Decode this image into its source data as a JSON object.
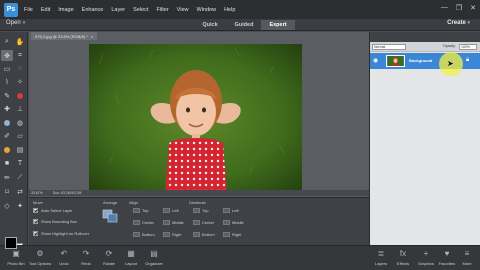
{
  "menu": {
    "logo": "Ps",
    "items": [
      "File",
      "Edit",
      "Image",
      "Enhance",
      "Layer",
      "Select",
      "Filter",
      "View",
      "Window",
      "Help"
    ]
  },
  "window_controls": {
    "minimize": "—",
    "restore": "❐",
    "close": "✕"
  },
  "modebar": {
    "open_label": "Open",
    "open_arrow": "▾",
    "modes": [
      "Quick",
      "Guided",
      "Expert"
    ],
    "active_mode": "Expert",
    "create_label": "Create",
    "create_arrow": "▾"
  },
  "document": {
    "tab_title": "975-2.jpg @ 33.8% (RGB/8) *",
    "tab_close": "×",
    "zoom": "33.87%",
    "doc_info": "Doc: 63.2M/63.2M"
  },
  "tool_options": {
    "move_title": "Move",
    "auto_select": "Auto Select Layer",
    "show_bounding_box": "Show Bounding Box",
    "show_highlight": "Show Highlight on Rollover",
    "arrange_title": "Arrange",
    "align_title": "Align",
    "align_labels": [
      "Top",
      "Left",
      "Center",
      "Middle",
      "Bottom",
      "Right"
    ],
    "distribute_title": "Distribute",
    "distribute_labels": [
      "Top",
      "Left",
      "Center",
      "Middle",
      "Bottom",
      "Right"
    ],
    "checks": {
      "auto_select": true,
      "bounding_box": true,
      "highlight": true
    }
  },
  "bottombar": {
    "left": [
      {
        "icon": "photo-bin-icon",
        "glyph": "▣",
        "label": "Photo Bin"
      },
      {
        "icon": "tool-options-icon",
        "glyph": "⚙",
        "label": "Tool Options"
      },
      {
        "icon": "undo-icon",
        "glyph": "↶",
        "label": "Undo"
      },
      {
        "icon": "redo-icon",
        "glyph": "↷",
        "label": "Redo"
      },
      {
        "icon": "rotate-icon",
        "glyph": "⟳",
        "label": "Rotate"
      },
      {
        "icon": "layout-icon",
        "glyph": "▦",
        "label": "Layout"
      },
      {
        "icon": "organizer-icon",
        "glyph": "▤",
        "label": "Organizer"
      }
    ],
    "right": [
      {
        "icon": "layers-icon",
        "glyph": "≣",
        "label": "Layers"
      },
      {
        "icon": "effects-icon",
        "glyph": "fx",
        "label": "Effects"
      },
      {
        "icon": "graphics-icon",
        "glyph": "+",
        "label": "Graphics"
      },
      {
        "icon": "favorites-icon",
        "glyph": "♥",
        "label": "Favorites"
      },
      {
        "icon": "more-icon",
        "glyph": "≡",
        "label": "More"
      }
    ]
  },
  "layers_panel": {
    "blend_mode": "Normal",
    "opacity_label": "Opacity:",
    "opacity_value": "100%",
    "layer_name": "Background",
    "layer_selected": true
  },
  "colors": {
    "menubar": "#2c2e32",
    "accent": "#3b86d6",
    "foreground_swatch": "#000000",
    "background_swatch": "#ffffff"
  }
}
